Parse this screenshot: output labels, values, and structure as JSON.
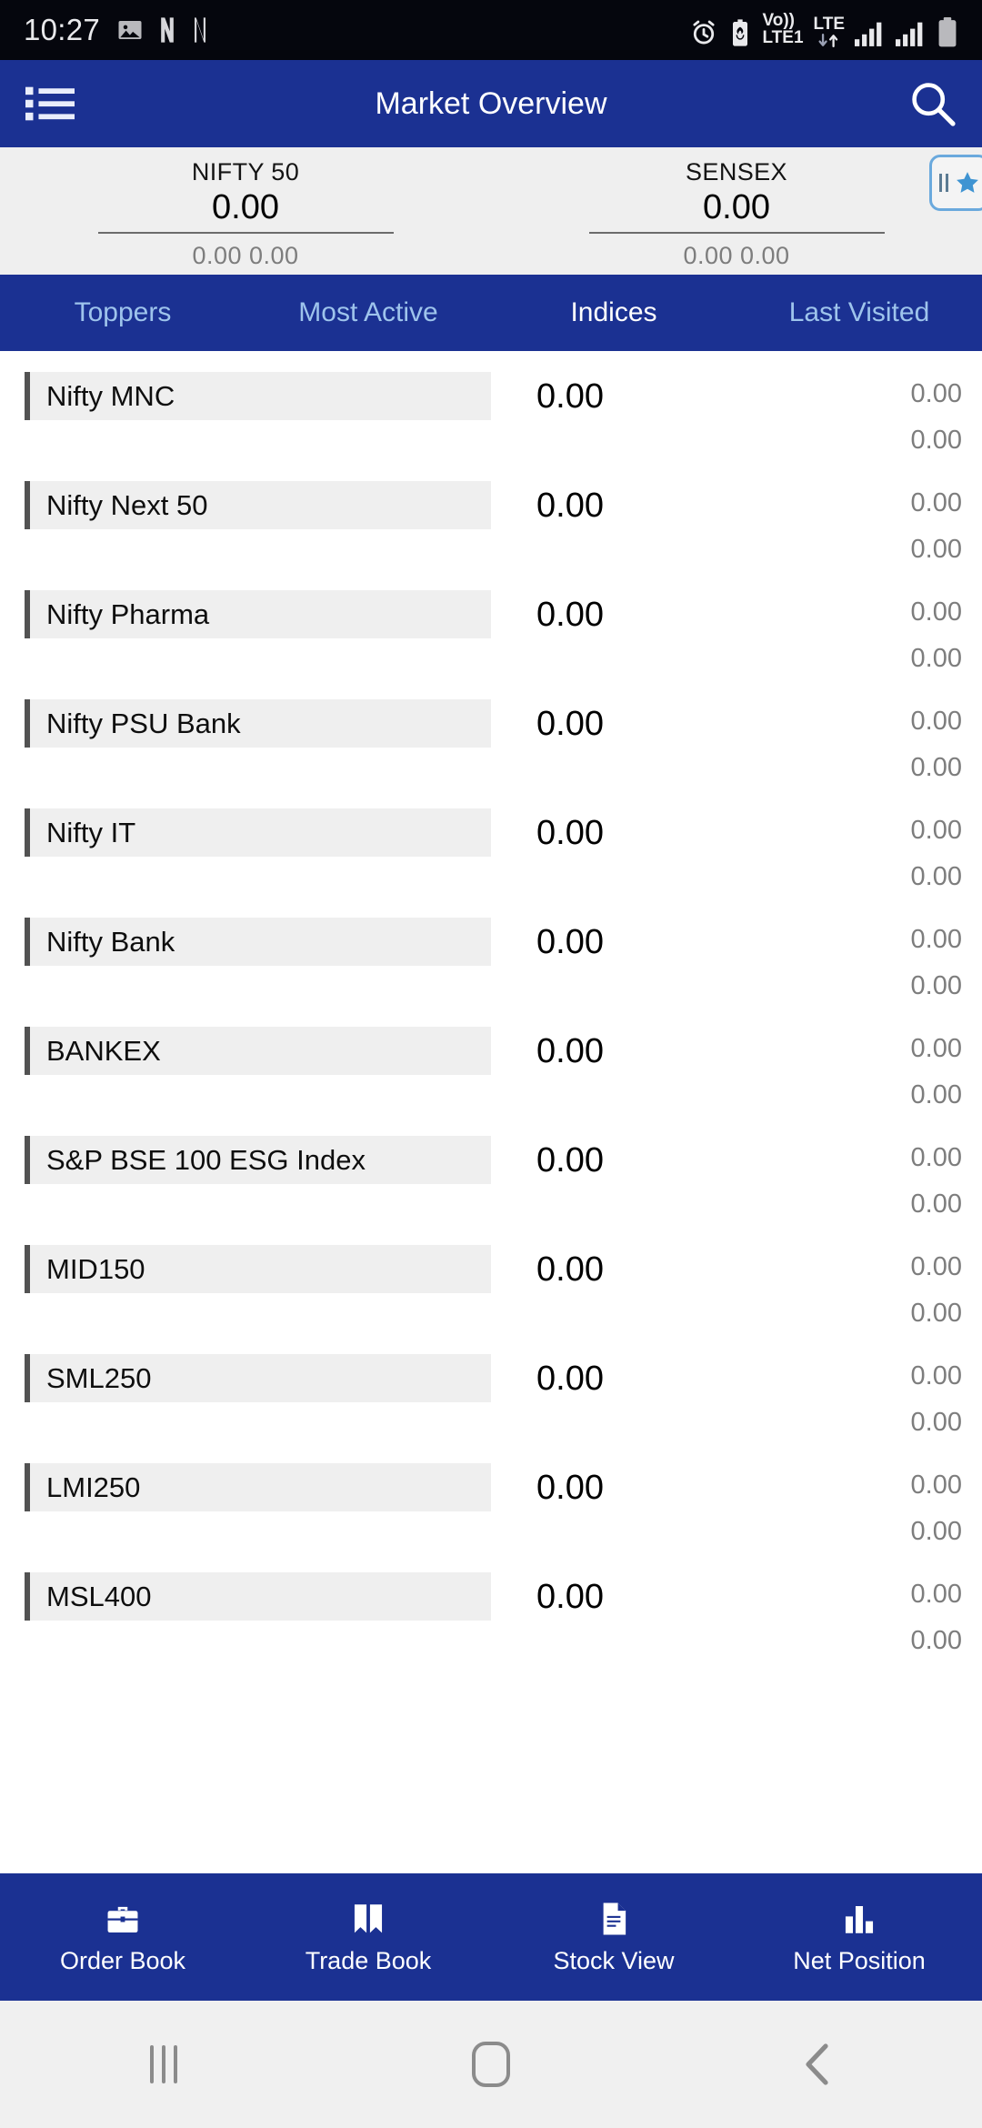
{
  "status_bar": {
    "clock": "10:27",
    "left_icons": [
      "image-icon",
      "netflix-n-icon",
      "netflix-n-icon-2"
    ],
    "volte_top": "Vo))",
    "volte_bottom": "LTE1",
    "lte_top": "LTE",
    "right_icons": [
      "alarm-icon",
      "battery-saver-icon",
      "volte-icon",
      "lte-data-icon",
      "signal-sim1-icon",
      "signal-sim2-icon",
      "battery-icon"
    ]
  },
  "app_bar": {
    "menu_icon": "list-menu-icon",
    "title": "Market Overview",
    "search_icon": "search-icon"
  },
  "index_strip": {
    "indices": [
      {
        "name": "NIFTY 50",
        "value": "0.00",
        "change": "0.00 0.00"
      },
      {
        "name": "SENSEX",
        "value": "0.00",
        "change": "0.00 0.00"
      }
    ],
    "fav_button": {
      "pause_icon": "pause-icon",
      "star_icon": "star-icon"
    }
  },
  "tabs": [
    {
      "label": "Toppers",
      "active": false
    },
    {
      "label": "Most Active",
      "active": false
    },
    {
      "label": "Indices",
      "active": true
    },
    {
      "label": "Last Visited",
      "active": false
    }
  ],
  "list": {
    "rows": [
      {
        "name": "Nifty MNC",
        "ltp": "0.00",
        "change": "0.00",
        "change_pct": "0.00"
      },
      {
        "name": "Nifty Next 50",
        "ltp": "0.00",
        "change": "0.00",
        "change_pct": "0.00"
      },
      {
        "name": "Nifty Pharma",
        "ltp": "0.00",
        "change": "0.00",
        "change_pct": "0.00"
      },
      {
        "name": "Nifty PSU Bank",
        "ltp": "0.00",
        "change": "0.00",
        "change_pct": "0.00"
      },
      {
        "name": "Nifty IT",
        "ltp": "0.00",
        "change": "0.00",
        "change_pct": "0.00"
      },
      {
        "name": "Nifty Bank",
        "ltp": "0.00",
        "change": "0.00",
        "change_pct": "0.00"
      },
      {
        "name": "BANKEX",
        "ltp": "0.00",
        "change": "0.00",
        "change_pct": "0.00"
      },
      {
        "name": "S&P BSE 100 ESG Index",
        "ltp": "0.00",
        "change": "0.00",
        "change_pct": "0.00"
      },
      {
        "name": "MID150",
        "ltp": "0.00",
        "change": "0.00",
        "change_pct": "0.00"
      },
      {
        "name": "SML250",
        "ltp": "0.00",
        "change": "0.00",
        "change_pct": "0.00"
      },
      {
        "name": "LMI250",
        "ltp": "0.00",
        "change": "0.00",
        "change_pct": "0.00"
      },
      {
        "name": "MSL400",
        "ltp": "0.00",
        "change": "0.00",
        "change_pct": "0.00"
      }
    ]
  },
  "bottom_nav": [
    {
      "label": "Order Book",
      "icon": "briefcase-icon"
    },
    {
      "label": "Trade Book",
      "icon": "open-book-icon"
    },
    {
      "label": "Stock View",
      "icon": "document-icon"
    },
    {
      "label": "Net Position",
      "icon": "bar-chart-icon"
    }
  ],
  "android_nav": [
    {
      "icon": "recents-icon"
    },
    {
      "icon": "home-icon"
    },
    {
      "icon": "back-icon"
    }
  ],
  "colors": {
    "brand_blue": "#1b3192",
    "status_bar_bg": "#05060d",
    "strip_bg": "#efefef",
    "pill_bg": "#efefef",
    "pill_bar": "#525252",
    "tab_inactive": "#9ec4ec",
    "tab_active": "#ffffff",
    "muted_text": "#7d7d7d",
    "fav_border": "#6aa9dd",
    "fav_star": "#3f94d2"
  }
}
